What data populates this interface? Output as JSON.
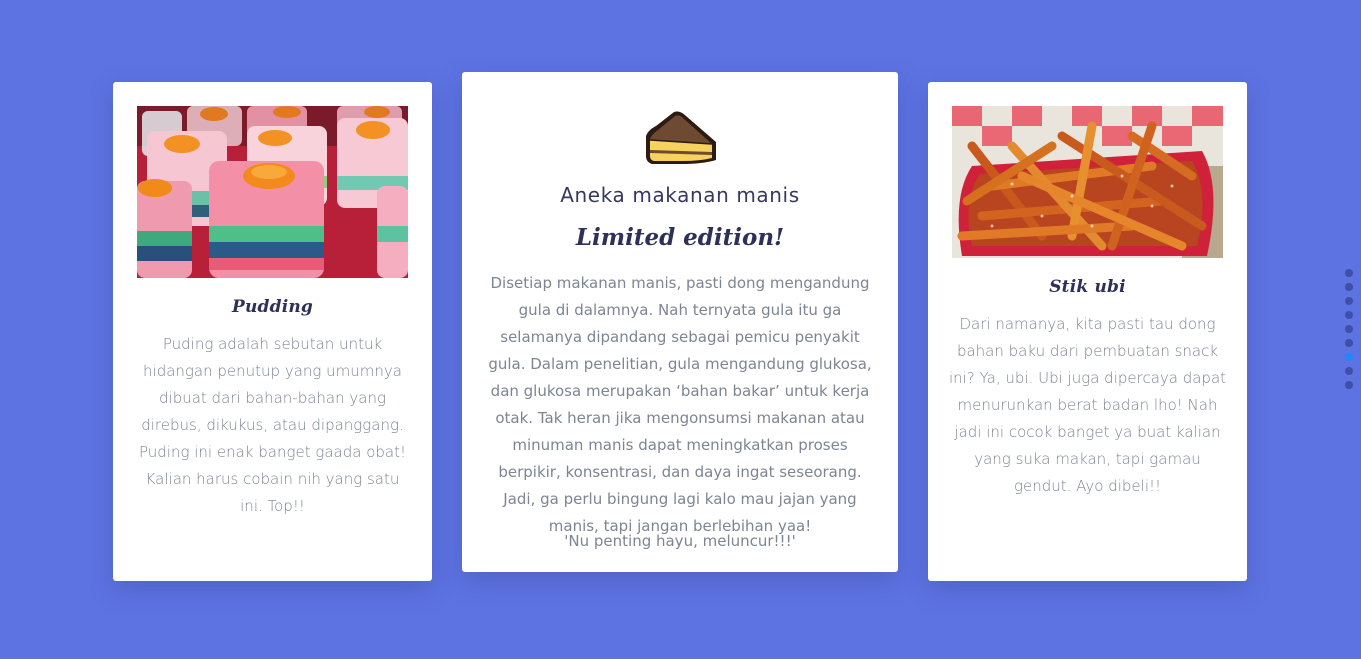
{
  "cards": [
    {
      "image": "pudding-photo",
      "title": "Pudding",
      "text": "Puding adalah sebutan untuk hidangan penutup yang umumnya dibuat dari bahan-bahan yang direbus, dikukus, atau dipanggang. Puding ini enak banget gaada obat! Kalian harus cobain nih yang satu ini. Top!!"
    },
    {
      "icon": "cake-slice-icon",
      "subtitle": "Aneka makanan manis",
      "title": "Limited edition!",
      "text": "Disetiap makanan manis, pasti dong mengandung gula di dalamnya. Nah ternyata gula itu ga selamanya dipandang sebagai pemicu penyakit gula. Dalam penelitian, gula mengandung glukosa, dan glukosa merupakan ‘bahan bakar’ untuk kerja otak. Tak heran jika mengonsumsi makanan atau minuman manis dapat meningkatkan proses berpikir, konsentrasi, dan daya ingat seseorang. Jadi, ga perlu bingung lagi kalo mau jajan yang manis, tapi jangan berlebihan yaa!",
      "quote": "'Nu penting hayu, meluncur!!!'"
    },
    {
      "image": "sweet-potato-fries-photo",
      "title": "Stik ubi",
      "text": "Dari namanya, kita pasti tau dong bahan baku dari pembuatan snack ini? Ya, ubi. Ubi juga dipercaya dapat menurunkan berat badan lho! Nah jadi ini cocok banget ya buat kalian yang suka makan, tapi gamau gendut. Ayo dibeli!!"
    }
  ],
  "pagination": {
    "count": 9,
    "active_index": 6
  },
  "colors": {
    "background": "#5d73e2",
    "card": "#ffffff",
    "heading": "#2d3157",
    "body_text": "#7d8593",
    "dot": "#3f4ea8",
    "dot_active": "#1e88ff"
  }
}
